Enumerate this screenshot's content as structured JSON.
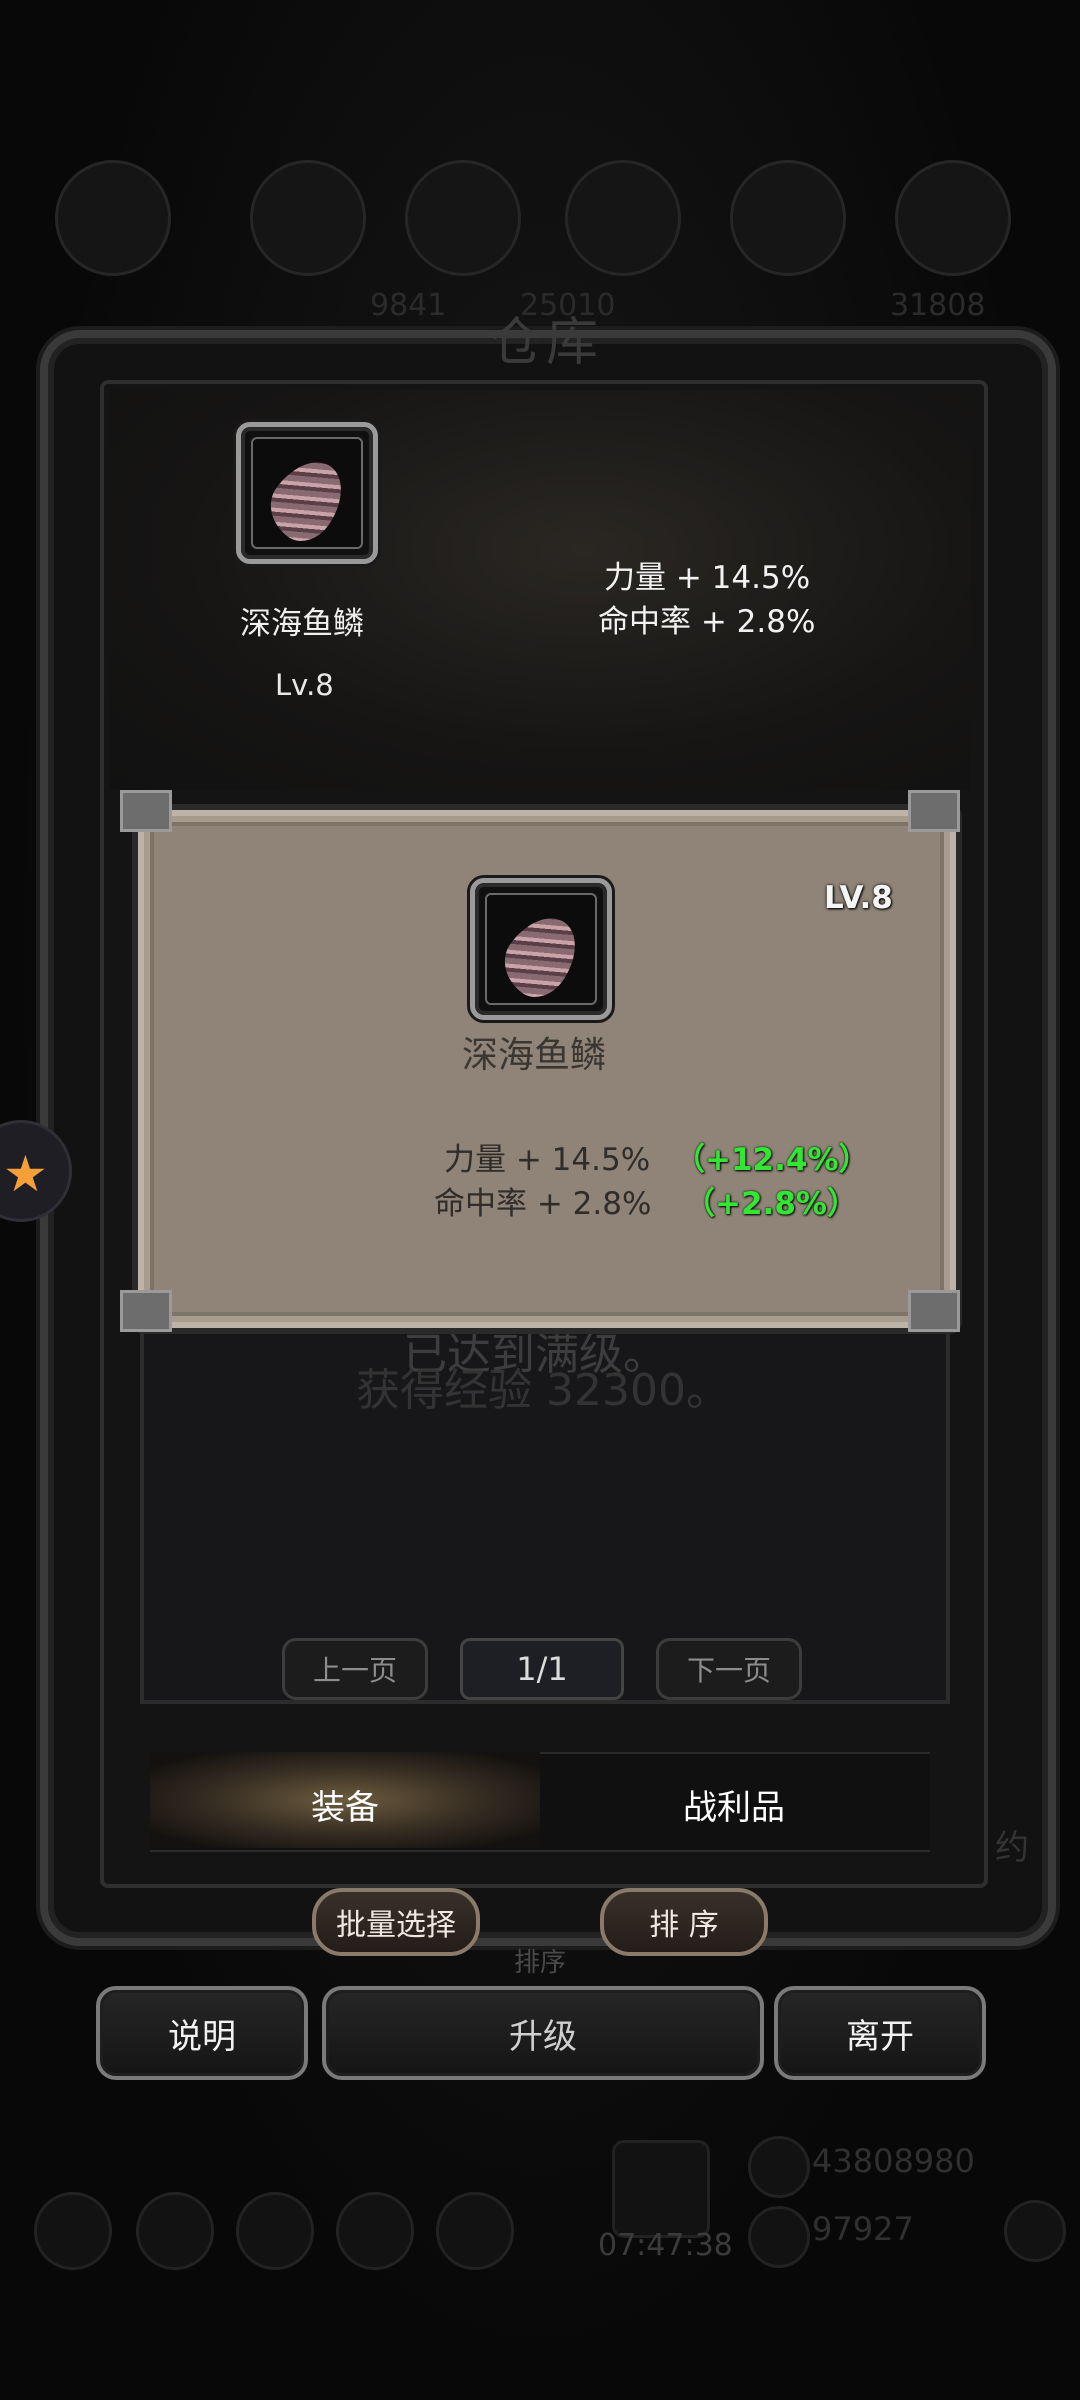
{
  "background": {
    "title": "仓库",
    "resource_numbers": [
      "9841",
      "25010",
      "31808"
    ],
    "gold": "43808980",
    "gems": "97927",
    "timer": "07:47:38",
    "hidden_label": "约",
    "behind_sort_label": "排序"
  },
  "top_panel": {
    "item_name": "深海鱼鳞",
    "item_level": "Lv.8",
    "stat_1": "力量 + 14.5%",
    "stat_2": "命中率 + 2.8%"
  },
  "card": {
    "level": "LV.8",
    "item_name": "深海鱼鳞",
    "stat_1": "力量 + 14.5%",
    "stat_1_bonus": "（+12.4%）",
    "stat_2": "命中率 + 2.8%",
    "stat_2_bonus": "（+2.8%）",
    "bonus_color": "#33e633"
  },
  "list": {
    "message_1": "已达到满级。",
    "message_2": "获得经验 32300。"
  },
  "pager": {
    "prev": "上一页",
    "page": "1/1",
    "next": "下一页"
  },
  "tabs": {
    "equipment": "装备",
    "loot": "战利品",
    "active": "装备"
  },
  "actions": {
    "batch_select": "批量选择",
    "sort": "排 序",
    "help": "说明",
    "upgrade": "升级",
    "leave": "离开"
  },
  "icons": {
    "item": "fish-scale-icon",
    "side_float": "star-icon"
  }
}
